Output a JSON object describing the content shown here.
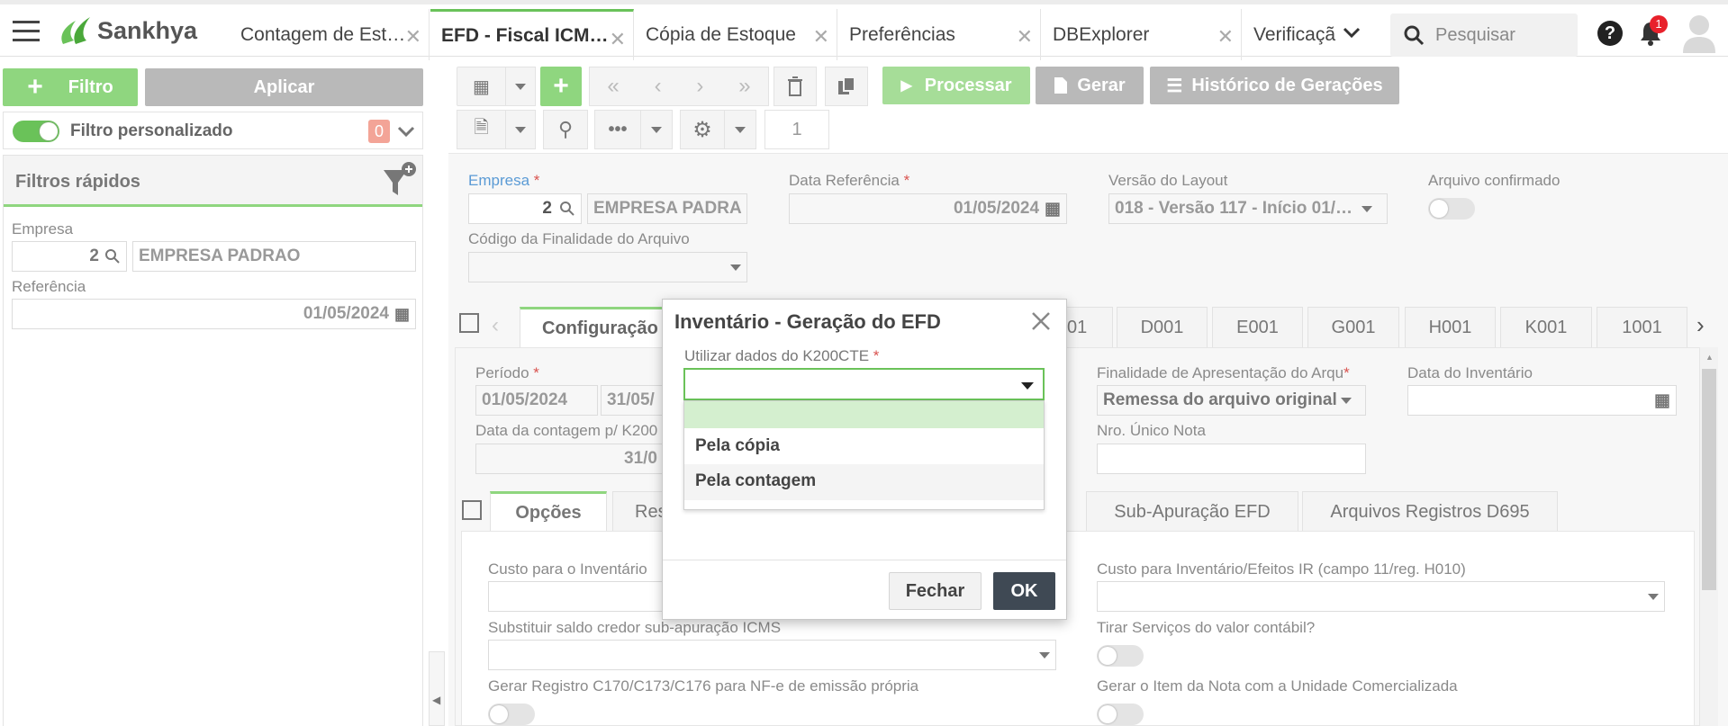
{
  "app": {
    "brand": "Sankhya"
  },
  "tabs": [
    {
      "label": "Contagem de Est…"
    },
    {
      "label": "EFD - Fiscal ICM…"
    },
    {
      "label": "Cópia de Estoque"
    },
    {
      "label": "Preferências"
    },
    {
      "label": "DBExplorer"
    },
    {
      "label": "Verificaçã"
    }
  ],
  "header": {
    "search_placeholder": "Pesquisar",
    "notifications": "1"
  },
  "left": {
    "filter_label": "Filtro",
    "apply_label": "Aplicar",
    "custom_filter_label": "Filtro personalizado",
    "custom_filter_count": "0",
    "quick_filters_title": "Filtros rápidos",
    "empresa_label": "Empresa",
    "empresa_code": "2",
    "empresa_name": "EMPRESA PADRAO",
    "referencia_label": "Referência",
    "referencia_value": "01/05/2024"
  },
  "toolbar": {
    "processar": "Processar",
    "gerar": "Gerar",
    "historico": "Histórico de Gerações",
    "page": "1"
  },
  "form": {
    "empresa_label": "Empresa",
    "empresa_code": "2",
    "empresa_name": "EMPRESA PADRA",
    "data_ref_label": "Data Referência",
    "data_ref_value": "01/05/2024",
    "versao_label": "Versão do Layout",
    "versao_value": "018 - Versão 117 - Início 01/…",
    "confirmado_label": "Arquivo confirmado",
    "finalidade_label": "Código da Finalidade do Arquivo"
  },
  "section_tabs": [
    {
      "label": "Configuração"
    },
    {
      "label": "01"
    },
    {
      "label": "D001"
    },
    {
      "label": "E001"
    },
    {
      "label": "G001"
    },
    {
      "label": "H001"
    },
    {
      "label": "K001"
    },
    {
      "label": "1001"
    }
  ],
  "config": {
    "periodo_label": "Período",
    "periodo_ini": "01/05/2024",
    "periodo_fim": "31/05/",
    "contagem_label": "Data da contagem p/ K200",
    "contagem_value": "31/0",
    "finalidade_apres_label": "Finalidade de Apresentação do Arqu",
    "finalidade_apres_value": "Remessa do arquivo original",
    "data_inv_label": "Data do Inventário",
    "nro_nota_label": "Nro. Único Nota"
  },
  "sub_tabs": [
    {
      "label": "Opções"
    },
    {
      "label": "Res"
    },
    {
      "label": "Sub-Apuração EFD"
    },
    {
      "label": "Arquivos Registros D695"
    }
  ],
  "options": {
    "custo_inv_label": "Custo para o Inventário",
    "custo_ir_label": "Custo para Inventário/Efeitos IR (campo 11/reg. H010)",
    "substituir_label": "Substituir saldo credor sub-apuração ICMS",
    "tirar_servicos_label": "Tirar Serviços do valor contábil?",
    "gerar_registro_label": "Gerar Registro C170/C173/C176 para NF-e de emissão própria",
    "gerar_item_label": "Gerar o Item da Nota com a Unidade Comercializada"
  },
  "modal": {
    "title": "Inventário - Geração do EFD",
    "field_label": "Utilizar dados do K200CTE",
    "options": [
      "",
      "Pela cópia",
      "Pela contagem"
    ],
    "close_label": "Fechar",
    "ok_label": "OK"
  },
  "colors": {
    "brand_green": "#6ac259",
    "ok_button": "#3f4954",
    "disabled_gray": "#b9b9b9"
  }
}
